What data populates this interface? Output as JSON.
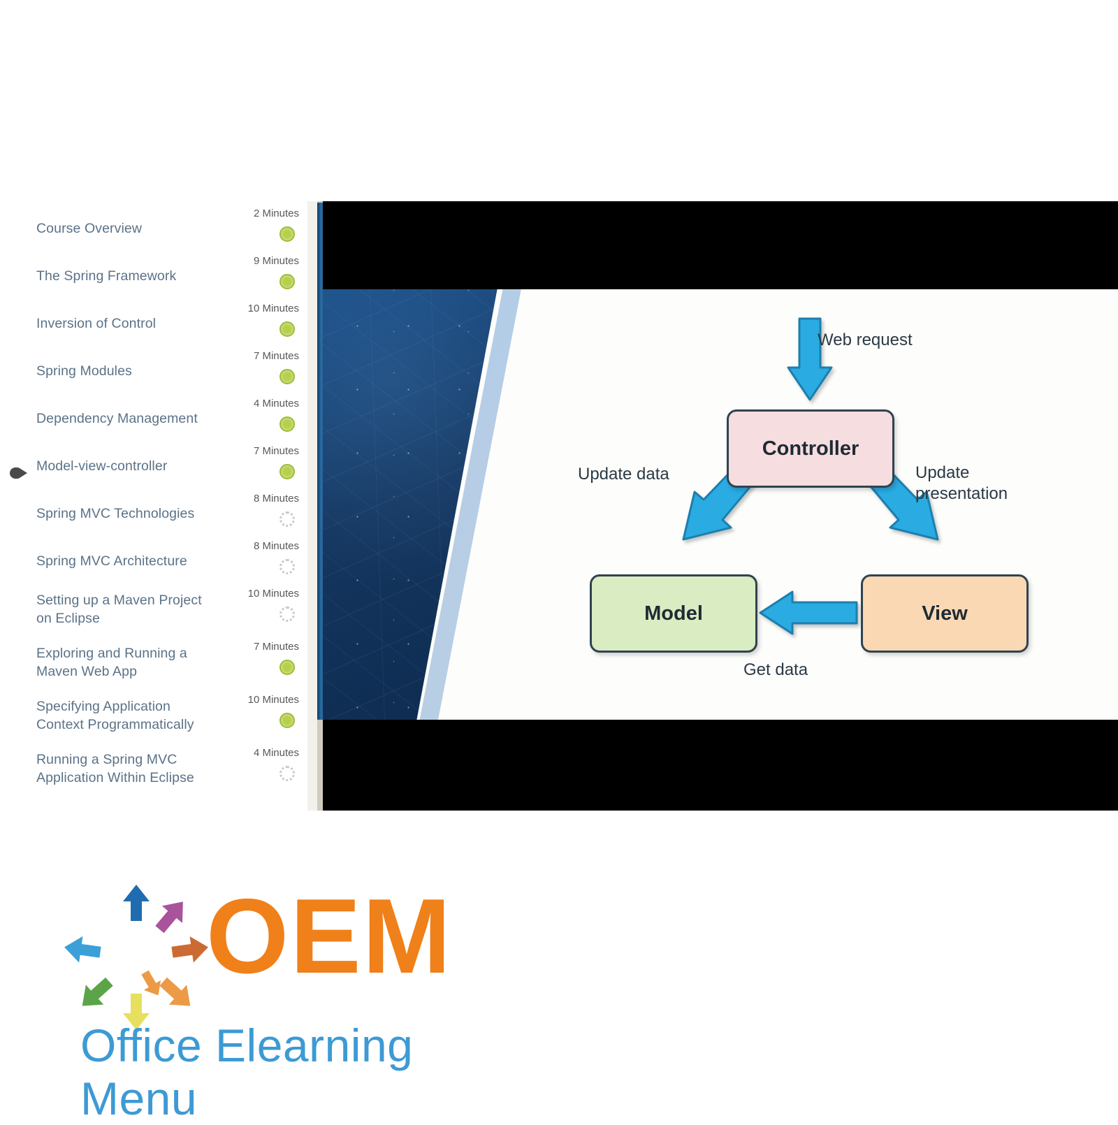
{
  "course_outline": {
    "items": [
      {
        "title": "Course Overview",
        "duration": "2 Minutes",
        "status": "complete",
        "current": false
      },
      {
        "title": "The Spring Framework",
        "duration": "9 Minutes",
        "status": "complete",
        "current": false
      },
      {
        "title": "Inversion of Control",
        "duration": "10 Minutes",
        "status": "complete",
        "current": false
      },
      {
        "title": "Spring Modules",
        "duration": "7 Minutes",
        "status": "complete",
        "current": false
      },
      {
        "title": "Dependency Management",
        "duration": "4 Minutes",
        "status": "complete",
        "current": false
      },
      {
        "title": "Model-view-controller",
        "duration": "7 Minutes",
        "status": "complete",
        "current": true
      },
      {
        "title": "Spring MVC Technologies",
        "duration": "8 Minutes",
        "status": "incomplete",
        "current": false
      },
      {
        "title": "Spring MVC Architecture",
        "duration": "8 Minutes",
        "status": "incomplete",
        "current": false
      },
      {
        "title": "Setting up a Maven Project on Eclipse",
        "duration": "10 Minutes",
        "status": "incomplete",
        "current": false
      },
      {
        "title": "Exploring and Running a Maven Web App",
        "duration": "7 Minutes",
        "status": "complete",
        "current": false
      },
      {
        "title": "Specifying Application Context Programmatically",
        "duration": "10 Minutes",
        "status": "complete",
        "current": false
      },
      {
        "title": "Running a Spring MVC Application Within Eclipse",
        "duration": "4 Minutes",
        "status": "incomplete",
        "current": false
      }
    ],
    "colors": {
      "title": "#5b7287",
      "duration": "#57585a",
      "complete_fill": "#b5d04a",
      "incomplete_border": "#c9c9c9",
      "current_marker": "#4a4a4a"
    }
  },
  "video_player": {
    "letterbox_color": "#000000",
    "scrollbar_thumb_color": "#1d5183",
    "scrollbar_track_color": "#cfcbbd"
  },
  "slide": {
    "wedge_color": "#14365f",
    "background_color": "#fdfdfb",
    "diagram": {
      "type": "diagram",
      "title": "Model-view-controller",
      "nodes": [
        {
          "id": "controller",
          "label": "Controller",
          "fill": "#f6dde0",
          "border": "#30434f"
        },
        {
          "id": "model",
          "label": "Model",
          "fill": "#d9ecc2",
          "border": "#30434f"
        },
        {
          "id": "view",
          "label": "View",
          "fill": "#fbd8b4",
          "border": "#30434f"
        }
      ],
      "edges": [
        {
          "from": "external",
          "to": "controller",
          "label": "Web request",
          "color": "#29 abe2"
        },
        {
          "from": "controller",
          "to": "model",
          "label": "Update data",
          "color": "#29abe2"
        },
        {
          "from": "controller",
          "to": "view",
          "label": "Update\npresentation",
          "color": "#29abe2"
        },
        {
          "from": "view",
          "to": "model",
          "label": "Get data",
          "color": "#29abe2"
        }
      ],
      "arrow_color": "#29abe2",
      "arrow_outline": "#1b7fae",
      "label_color": "#2b3a44"
    }
  },
  "logo": {
    "wordmark": "OEM",
    "tagline": "Office Elearning Menu",
    "wordmark_color": "#f08019",
    "tagline_color": "#3d9ad4",
    "arrows": [
      {
        "name": "arrow-up-blue",
        "color": "#1f6cb0",
        "rotation": 0
      },
      {
        "name": "arrow-up-right-purple",
        "color": "#a8539c",
        "rotation": 35
      },
      {
        "name": "arrow-right-rust",
        "color": "#cb6b33",
        "rotation": 90
      },
      {
        "name": "arrow-down-right-orange",
        "color": "#ec9a45",
        "rotation": 135
      },
      {
        "name": "arrow-down-yellow",
        "color": "#e6e05e",
        "rotation": 180
      },
      {
        "name": "arrow-down-left-green",
        "color": "#5ba448",
        "rotation": 225
      },
      {
        "name": "arrow-left-lightblue",
        "color": "#3ba0d8",
        "rotation": 290
      }
    ]
  }
}
